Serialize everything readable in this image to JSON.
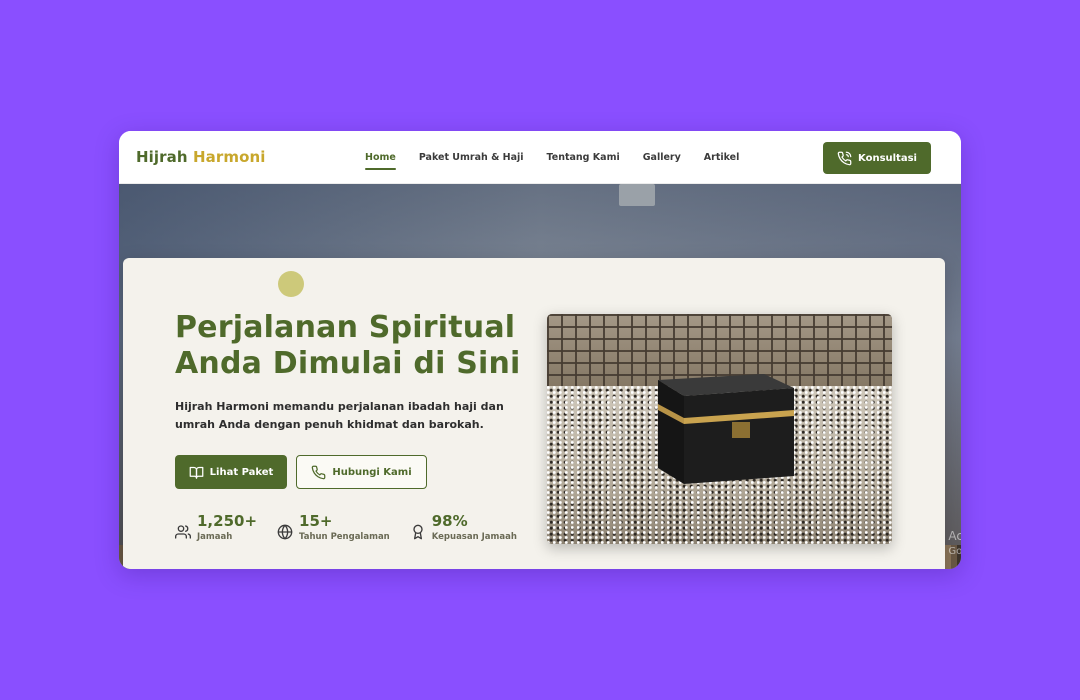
{
  "brand": {
    "part1": "Hijrah",
    "part2": "Harmoni"
  },
  "nav": {
    "items": [
      {
        "label": "Home",
        "active": true
      },
      {
        "label": "Paket Umrah & Haji",
        "active": false
      },
      {
        "label": "Tentang Kami",
        "active": false
      },
      {
        "label": "Gallery",
        "active": false
      },
      {
        "label": "Artikel",
        "active": false
      }
    ],
    "cta_label": "Konsultasi"
  },
  "hero": {
    "headline_line1": "Perjalanan Spiritual",
    "headline_line2": "Anda Dimulai di Sini",
    "subtitle": "Hijrah Harmoni memandu perjalanan ibadah haji dan umrah Anda dengan penuh khidmat dan barokah.",
    "primary_button": "Lihat Paket",
    "secondary_button": "Hubungi Kami",
    "stats": [
      {
        "value": "1,250+",
        "label": "Jamaah",
        "icon": "users-icon"
      },
      {
        "value": "15+",
        "label": "Tahun Pengalaman",
        "icon": "globe-icon"
      },
      {
        "value": "98%",
        "label": "Kepuasan Jamaah",
        "icon": "award-icon"
      }
    ],
    "image_alt": "Kaaba surrounded by pilgrims"
  },
  "watermark": {
    "line1": "Ac",
    "line2": "Go"
  },
  "colors": {
    "brand_green": "#4f6a2b",
    "brand_gold": "#c8a72c",
    "page_background": "#8a4fff",
    "card_background": "#f4f2ec"
  }
}
